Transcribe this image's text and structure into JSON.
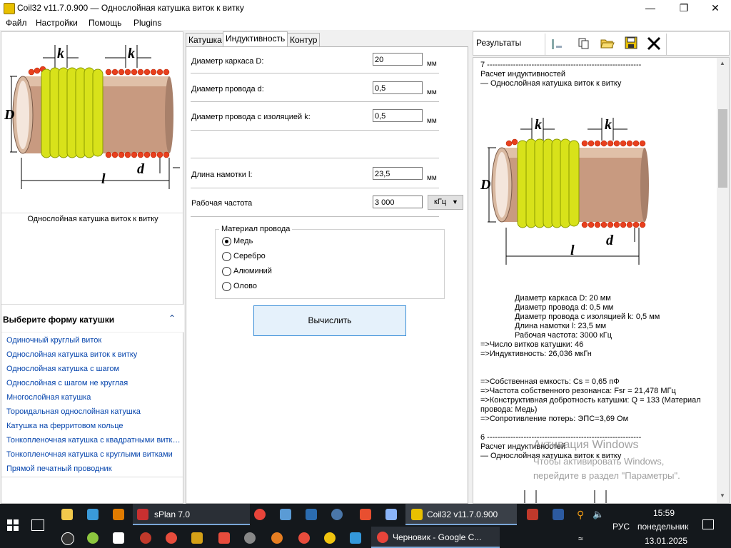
{
  "window": {
    "title": "Coil32 v11.7.0.900 — Однослойная катушка виток к витку",
    "minimize": "—",
    "maximize": "❐",
    "close": "✕"
  },
  "menu": [
    "Файл",
    "Настройки",
    "Помощь",
    "Plugins"
  ],
  "left": {
    "diagram": {
      "k1": "k",
      "k2": "k",
      "D": "D",
      "l": "l",
      "d": "d"
    },
    "caption": "Однослойная катушка виток к витку",
    "section_title": "Выберите форму катушки",
    "shapes": [
      "Одиночный круглый виток",
      "Однослойная катушка виток к витку",
      "Однослойная катушка с шагом",
      "Однослойная с шагом не круглая",
      "Многослойная катушка",
      "Тороидальная однослойная катушка",
      "Катушка на ферритовом кольце",
      "Тонкопленочная катушка с квадратными витками",
      "Тонкопленочная катушка с круглыми витками",
      "Прямой печатный проводник"
    ]
  },
  "tabs": [
    "Катушка",
    "Индуктивность",
    "Контур"
  ],
  "form": {
    "fields": [
      {
        "label": "Диаметр каркаса D:",
        "value": "20",
        "unit": "мм"
      },
      {
        "label": "Диаметр провода d:",
        "value": "0,5",
        "unit": "мм"
      },
      {
        "label": "Диаметр провода с изоляцией k:",
        "value": "0,5",
        "unit": "мм"
      },
      {
        "label": "Длина намотки l:",
        "value": "23,5",
        "unit": "мм"
      },
      {
        "label": "Рабочая частота",
        "value": "3 000",
        "unit": ""
      }
    ],
    "freq_unit": "кГц",
    "material_title": "Материал провода",
    "materials": [
      "Медь",
      "Серебро",
      "Алюминий",
      "Олово"
    ],
    "selected_material": "Медь",
    "calc_button": "Вычислить"
  },
  "results": {
    "header_label": "Результаты",
    "diagram": {
      "k1": "k",
      "k2": "k",
      "D": "D",
      "l": "l",
      "d": "d"
    },
    "block1_top": [
      "7 -----------------------------------------------------------",
      "Расчет индуктивностей",
      "— Однослойная катушка виток к витку"
    ],
    "params": [
      "Диаметр каркаса D: 20 мм",
      "Диаметр провода d: 0,5 мм",
      "Диаметр провода с изоляцией k: 0,5 мм",
      "Длина намотки l: 23,5 мм",
      "Рабочая частота: 3000 кГц"
    ],
    "res1": [
      "=>Число витков катушки: 46",
      "=>Индуктивность: 26,036 мкГн"
    ],
    "res2": [
      "=>Собственная емкость: Cs = 0,65 пФ",
      "=>Частота собственного резонанса: Fsr = 21,478 МГц",
      "=>Конструктивная добротность катушки: Q = 133 (Материал",
      "провода: Медь)",
      "=>Сопротивление потерь: ЭПС=3,69 Ом"
    ],
    "block2_top": [
      "6 -----------------------------------------------------------",
      "Расчет индуктивностей",
      "— Однослойная катушка виток к витку"
    ],
    "watermark_title": "Активация Windows",
    "watermark_line1": "Чтобы активировать Windows,",
    "watermark_line2": "перейдите в раздел \"Параметры\"."
  },
  "taskbar": {
    "splan": "sPlan 7.0",
    "coil": "Coil32 v11.7.0.900",
    "chrome": "Черновик - Google C...",
    "lang": "РУС",
    "time": "15:59",
    "day": "понедельник",
    "date": "13.01.2025"
  },
  "colors": {
    "coil_green": "#d8e21a",
    "wire_red": "#e8401e",
    "pipe": "#c89a80",
    "link": "#0645ad"
  }
}
